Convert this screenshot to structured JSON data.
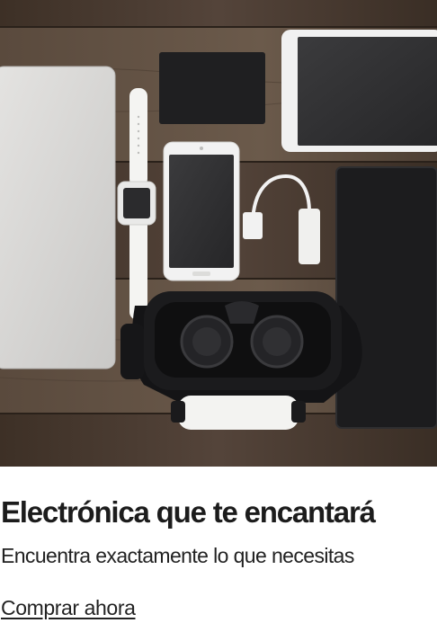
{
  "promo": {
    "image_alt": "electronics-flatlay",
    "title": "Electrónica que te encantará",
    "subtitle": "Encuentra exactamente lo que necesitas",
    "cta_label": "Comprar ahora"
  },
  "colors": {
    "title": "#1c1c1c",
    "text": "#222222",
    "background": "#ffffff",
    "wood": "#4a3b2f"
  }
}
